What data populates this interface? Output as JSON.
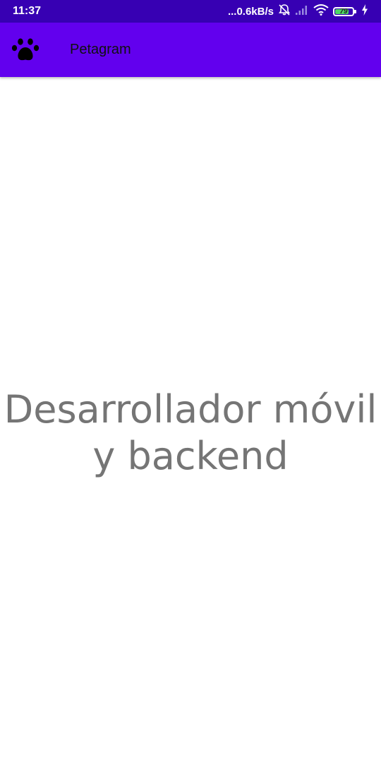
{
  "status_bar": {
    "time": "11:37",
    "network_speed": "...0.6kB/s",
    "battery_level": "79",
    "battery_fill_percent": 79,
    "background_color": "#3700b3",
    "icons": [
      "mute-alarm-icon",
      "signal-icon",
      "wifi-icon",
      "battery-icon",
      "charging-icon"
    ]
  },
  "app_bar": {
    "title": "Petagram",
    "icon": "paw-icon",
    "background_color": "#6200ee"
  },
  "main": {
    "text_line1": "Desarrollador móvil",
    "text_line2": "y backend",
    "text_color": "#757575"
  }
}
